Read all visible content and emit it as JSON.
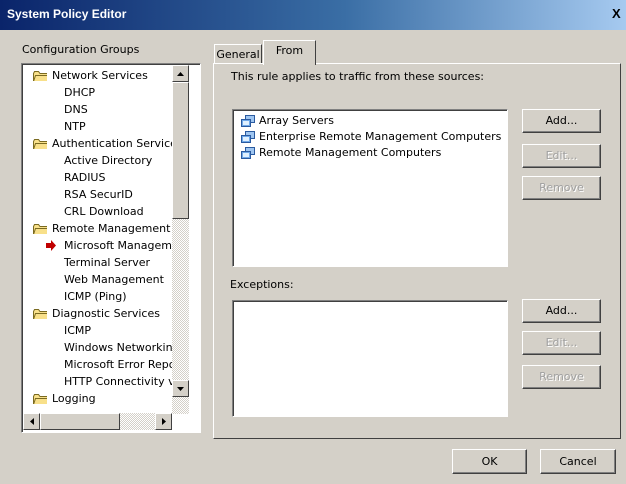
{
  "window": {
    "title": "System Policy Editor",
    "close_glyph": "X"
  },
  "left_panel": {
    "label": "Configuration Groups",
    "tree": [
      {
        "text": "Network Services",
        "level": 0
      },
      {
        "text": "DHCP",
        "level": 1
      },
      {
        "text": "DNS",
        "level": 1
      },
      {
        "text": "NTP",
        "level": 1
      },
      {
        "text": "Authentication Services",
        "level": 0
      },
      {
        "text": "Active Directory",
        "level": 1
      },
      {
        "text": "RADIUS",
        "level": 1
      },
      {
        "text": "RSA SecurID",
        "level": 1
      },
      {
        "text": "CRL Download",
        "level": 1
      },
      {
        "text": "Remote Management",
        "level": 0
      },
      {
        "text": "Microsoft Manageme",
        "level": 1,
        "marker": "red-arrow"
      },
      {
        "text": "Terminal Server",
        "level": 1
      },
      {
        "text": "Web Management",
        "level": 1
      },
      {
        "text": "ICMP (Ping)",
        "level": 1
      },
      {
        "text": "Diagnostic Services",
        "level": 0
      },
      {
        "text": "ICMP",
        "level": 1
      },
      {
        "text": "Windows Networking",
        "level": 1
      },
      {
        "text": "Microsoft Error Repo",
        "level": 1
      },
      {
        "text": "HTTP Connectivity ve",
        "level": 1
      },
      {
        "text": "Logging",
        "level": 0
      }
    ]
  },
  "tabs": [
    {
      "label": "General",
      "active": false
    },
    {
      "label": "From",
      "active": true
    }
  ],
  "from_tab": {
    "sources_label": "This rule applies to traffic from these sources:",
    "sources": [
      {
        "text": "Array Servers",
        "icon": "computer-set-icon"
      },
      {
        "text": "Enterprise Remote Management Computers",
        "icon": "computer-set-icon"
      },
      {
        "text": "Remote Management Computers",
        "icon": "computer-set-icon"
      }
    ],
    "source_buttons": {
      "add": "Add...",
      "edit": "Edit...",
      "remove": "Remove"
    },
    "exceptions_label": "Exceptions:",
    "exception_buttons": {
      "add": "Add...",
      "edit": "Edit...",
      "remove": "Remove"
    }
  },
  "footer": {
    "ok": "OK",
    "cancel": "Cancel"
  },
  "colors": {
    "title_gradient_start": "#0a246a",
    "title_gradient_end": "#a6caf0",
    "face": "#d4d0c8",
    "marker_red": "#c00000"
  }
}
